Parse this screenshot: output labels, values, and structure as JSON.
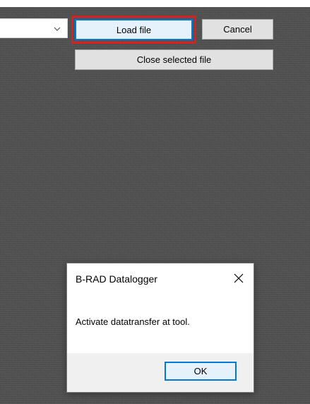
{
  "toolbar": {
    "file_select_value": "",
    "load_file_label": "Load file",
    "cancel_label": "Cancel",
    "close_selected_file_label": "Close selected file"
  },
  "dialog": {
    "title": "B-RAD Datalogger",
    "message": "Activate datatransfer at tool.",
    "ok_label": "OK"
  },
  "icons": {
    "dropdown": "chevron-down-icon",
    "dialog_close": "close-icon"
  },
  "colors": {
    "highlight_border": "#d92020",
    "focus_border": "#0078d7",
    "button_face": "#e1e1e1",
    "background": "#515151"
  }
}
